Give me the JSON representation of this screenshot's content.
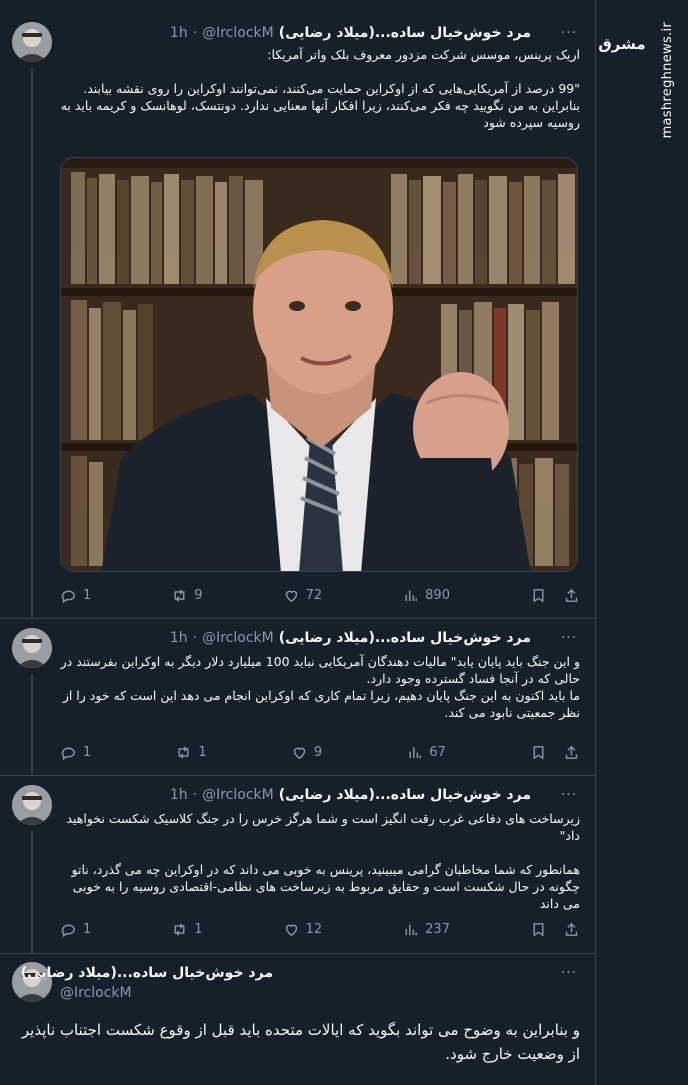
{
  "watermark": {
    "logo_text": "مشرق",
    "site": "mashreghnews.ir"
  },
  "colors": {
    "background": "#15202b",
    "text": "#f7f9f9",
    "muted": "#8b98a5",
    "border": "#38444d"
  },
  "tweets": [
    {
      "name": "مرد خوش‌خیال ساده...(میلاد رضایی)",
      "handle": "@IrclockM",
      "dot": "·",
      "time": "1h",
      "lines": [
        "اریک پرینس، موسس شرکت مزدور معروف بلک واتر آمریکا:",
        "",
        "\"99 درصد از آمریکایی‌هایی که از اوکراین حمایت می‌کنند، نمی‌توانند اوکراین را روی نقشه بیابند.",
        "بنابراین به من نگویید چه فکر می‌کنند، زیرا افکار آنها معنایی ندارد. دونتسک، لوهانسک و کریمه باید به روسیه سپرده شود"
      ],
      "image_alt": "photo",
      "stats": {
        "replies": "1",
        "retweets": "9",
        "likes": "72",
        "views": "890"
      }
    },
    {
      "name": "مرد خوش‌خیال ساده...(میلاد رضایی)",
      "handle": "@IrclockM",
      "dot": "·",
      "time": "1h",
      "lines": [
        "و این جنگ باید پایان یابد\" مالیات دهندگان آمریکایی نباید 100 میلیارد دلار دیگر به اوکراین بفرستند در حالی که در آنجا فساد گسترده وجود دارد.",
        "ما باید اکنون به این جنگ پایان دهیم، زیرا تمام کاری که اوکراین انجام می دهد این است که خود را از نظر جمعیتی نابود می کند."
      ],
      "stats": {
        "replies": "1",
        "retweets": "1",
        "likes": "9",
        "views": "67"
      }
    },
    {
      "name": "مرد خوش‌خیال ساده...(میلاد رضایی)",
      "handle": "@IrclockM",
      "dot": "·",
      "time": "1h",
      "lines": [
        "زیرساخت های دفاعی غرب رقت انگیز است و شما هرگز خرس را در جنگ کلاسیک شکست نخواهید داد\"",
        "",
        "همانطور که شما مخاطبان گرامی میبینید، پرینس به خوبی می داند که در اوکراین چه می گذرد، ناتو چگونه در حال شکست است و حقایق مربوط به زیرساخت های نظامی-اقتصادی روسیه را به خوبی می داند"
      ],
      "stats": {
        "replies": "1",
        "retweets": "1",
        "likes": "12",
        "views": "237"
      }
    },
    {
      "name": "مرد خوش‌خیال ساده...(میلاد رضایی)",
      "handle": "@IrclockM",
      "text": "و بنابراین به وضوح می تواند بگوید که ایالات متحده باید قبل از وقوع شکست اجتناب ناپذیر از وضعیت خارج شود."
    }
  ]
}
